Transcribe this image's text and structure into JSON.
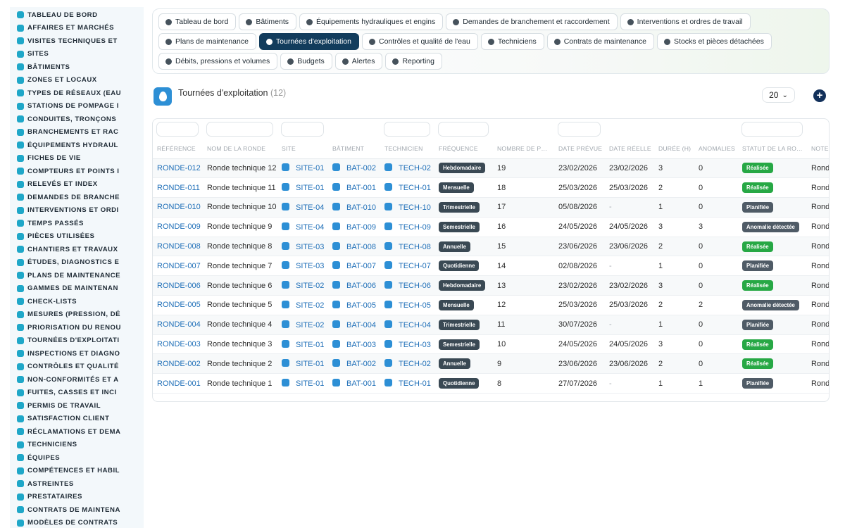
{
  "sidebar": {
    "items": [
      {
        "label": "TABLEAU DE BORD",
        "icon": "dashboard-icon"
      },
      {
        "label": "AFFAIRES ET MARCHÉS",
        "icon": "target-icon"
      },
      {
        "label": "VISITES TECHNIQUES ET",
        "icon": "clipboard-icon"
      },
      {
        "label": "SITES",
        "icon": "map-pin-icon"
      },
      {
        "label": "BÂTIMENTS",
        "icon": "building-icon"
      },
      {
        "label": "ZONES ET LOCAUX",
        "icon": "grid-icon"
      },
      {
        "label": "TYPES DE RÉSEAUX (EAU",
        "icon": "network-icon"
      },
      {
        "label": "STATIONS DE POMPAGE I",
        "icon": "pump-icon"
      },
      {
        "label": "CONDUITES, TRONÇONS",
        "icon": "pipe-icon"
      },
      {
        "label": "BRANCHEMENTS ET RAC",
        "icon": "plug-icon"
      },
      {
        "label": "ÉQUIPEMENTS HYDRAUL",
        "icon": "gear-icon"
      },
      {
        "label": "FICHES DE VIE",
        "icon": "history-icon"
      },
      {
        "label": "COMPTEURS ET POINTS I",
        "icon": "gauge-icon"
      },
      {
        "label": "RELEVÉS ET INDEX",
        "icon": "list-icon"
      },
      {
        "label": "DEMANDES DE BRANCHE",
        "icon": "request-icon"
      },
      {
        "label": "INTERVENTIONS ET ORDI",
        "icon": "wrench-icon"
      },
      {
        "label": "TEMPS PASSÉS",
        "icon": "clock-icon"
      },
      {
        "label": "PIÈCES UTILISÉES",
        "icon": "box-icon"
      },
      {
        "label": "CHANTIERS ET TRAVAUX",
        "icon": "hammer-icon"
      },
      {
        "label": "ÉTUDES, DIAGNOSTICS E",
        "icon": "search-icon"
      },
      {
        "label": "PLANS DE MAINTENANCE",
        "icon": "calendar-icon"
      },
      {
        "label": "GAMMES DE MAINTENAN",
        "icon": "layers-icon"
      },
      {
        "label": "CHECK-LISTS",
        "icon": "checklist-icon"
      },
      {
        "label": "MESURES (PRESSION, DÉ",
        "icon": "thermometer-icon"
      },
      {
        "label": "PRIORISATION DU RENOU",
        "icon": "chart-icon"
      },
      {
        "label": "TOURNÉES D'EXPLOITATI",
        "icon": "route-icon"
      },
      {
        "label": "INSPECTIONS ET DIAGNO",
        "icon": "eye-icon"
      },
      {
        "label": "CONTRÔLES ET QUALITÉ",
        "icon": "flask-icon"
      },
      {
        "label": "NON-CONFORMITÉS ET A",
        "icon": "alert-icon"
      },
      {
        "label": "FUITES, CASSES ET INCI",
        "icon": "warning-icon"
      },
      {
        "label": "PERMIS DE TRAVAIL",
        "icon": "document-icon"
      },
      {
        "label": "SATISFACTION CLIENT",
        "icon": "smile-icon"
      },
      {
        "label": "RÉCLAMATIONS ET DEMA",
        "icon": "chat-icon"
      },
      {
        "label": "TECHNICIENS",
        "icon": "person-icon"
      },
      {
        "label": "ÉQUIPES",
        "icon": "team-icon"
      },
      {
        "label": "COMPÉTENCES ET HABIL",
        "icon": "badge-icon"
      },
      {
        "label": "ASTREINTES",
        "icon": "phone-icon"
      },
      {
        "label": "PRESTATAIRES",
        "icon": "handshake-icon"
      },
      {
        "label": "CONTRATS DE MAINTENA",
        "icon": "contract-icon"
      },
      {
        "label": "MODÈLES DE CONTRATS",
        "icon": "template-icon"
      }
    ]
  },
  "tabs": {
    "row1": [
      {
        "label": "Tableau de bord",
        "icon": "dashboard-icon"
      },
      {
        "label": "Bâtiments",
        "icon": "building-icon"
      },
      {
        "label": "Équipements hydrauliques et engins",
        "icon": "gears-icon"
      },
      {
        "label": "Demandes de branchement et raccordement",
        "icon": "question-icon"
      },
      {
        "label": "Interventions et ordres de travail",
        "icon": "clipboard-icon"
      }
    ],
    "row2": [
      {
        "label": "Plans de maintenance",
        "icon": "calendar-icon"
      },
      {
        "label": "Tournées d'exploitation",
        "icon": "route-icon",
        "active": true
      },
      {
        "label": "Contrôles et qualité de l'eau",
        "icon": "clipboard-check-icon"
      },
      {
        "label": "Techniciens",
        "icon": "helmet-icon"
      },
      {
        "label": "Contrats de maintenance",
        "icon": "contract-icon"
      },
      {
        "label": "Stocks et pièces détachées",
        "icon": "boxes-icon"
      }
    ],
    "row3": [
      {
        "label": "Débits, pressions et volumes",
        "icon": "bolt-icon"
      },
      {
        "label": "Budgets",
        "icon": "money-icon"
      },
      {
        "label": "Alertes",
        "icon": "bell-icon"
      },
      {
        "label": "Reporting",
        "icon": "pie-icon"
      }
    ]
  },
  "page": {
    "title": "Tournées d'exploitation",
    "count": "(12)",
    "page_size": "20",
    "page_size_caret": "⌄",
    "add_label": "+"
  },
  "table": {
    "columns": [
      "RÉFÉRENCE",
      "NOM DE LA RONDE",
      "SITE",
      "BÂTIMENT",
      "TECHNICIEN",
      "FRÉQUENCE",
      "NOMBRE DE P…",
      "DATE PRÉVUE",
      "DATE RÉELLE",
      "DURÉE (H)",
      "ANOMALIES",
      "STATUT DE LA RO…",
      "NOTE"
    ],
    "rows": [
      {
        "ref": "RONDE-012",
        "name": "Ronde technique 12",
        "site": "SITE-01",
        "building": "BAT-002",
        "tech": "TECH-02",
        "freq": "Hebdomadaire",
        "points": "19",
        "planned": "23/02/2026",
        "actual": "23/02/2026",
        "duration": "3",
        "anomalies": "0",
        "status": "Réalisée",
        "status_kind": "ok",
        "note": "Ronde"
      },
      {
        "ref": "RONDE-011",
        "name": "Ronde technique 11",
        "site": "SITE-01",
        "building": "BAT-001",
        "tech": "TECH-01",
        "freq": "Mensuelle",
        "points": "18",
        "planned": "25/03/2026",
        "actual": "25/03/2026",
        "duration": "2",
        "anomalies": "0",
        "status": "Réalisée",
        "status_kind": "ok",
        "note": "Ronde"
      },
      {
        "ref": "RONDE-010",
        "name": "Ronde technique 10",
        "site": "SITE-04",
        "building": "BAT-010",
        "tech": "TECH-10",
        "freq": "Trimestrielle",
        "points": "17",
        "planned": "05/08/2026",
        "actual": "-",
        "duration": "1",
        "anomalies": "0",
        "status": "Planifiée",
        "status_kind": "plan",
        "note": "Ronde"
      },
      {
        "ref": "RONDE-009",
        "name": "Ronde technique 9",
        "site": "SITE-04",
        "building": "BAT-009",
        "tech": "TECH-09",
        "freq": "Semestrielle",
        "points": "16",
        "planned": "24/05/2026",
        "actual": "24/05/2026",
        "duration": "3",
        "anomalies": "3",
        "status": "Anomalie détectée",
        "status_kind": "anom",
        "note": "Ronde"
      },
      {
        "ref": "RONDE-008",
        "name": "Ronde technique 8",
        "site": "SITE-03",
        "building": "BAT-008",
        "tech": "TECH-08",
        "freq": "Annuelle",
        "points": "15",
        "planned": "23/06/2026",
        "actual": "23/06/2026",
        "duration": "2",
        "anomalies": "0",
        "status": "Réalisée",
        "status_kind": "ok",
        "note": "Ronde"
      },
      {
        "ref": "RONDE-007",
        "name": "Ronde technique 7",
        "site": "SITE-03",
        "building": "BAT-007",
        "tech": "TECH-07",
        "freq": "Quotidienne",
        "points": "14",
        "planned": "02/08/2026",
        "actual": "-",
        "duration": "1",
        "anomalies": "0",
        "status": "Planifiée",
        "status_kind": "plan",
        "note": "Ronde"
      },
      {
        "ref": "RONDE-006",
        "name": "Ronde technique 6",
        "site": "SITE-02",
        "building": "BAT-006",
        "tech": "TECH-06",
        "freq": "Hebdomadaire",
        "points": "13",
        "planned": "23/02/2026",
        "actual": "23/02/2026",
        "duration": "3",
        "anomalies": "0",
        "status": "Réalisée",
        "status_kind": "ok",
        "note": "Ronde"
      },
      {
        "ref": "RONDE-005",
        "name": "Ronde technique 5",
        "site": "SITE-02",
        "building": "BAT-005",
        "tech": "TECH-05",
        "freq": "Mensuelle",
        "points": "12",
        "planned": "25/03/2026",
        "actual": "25/03/2026",
        "duration": "2",
        "anomalies": "2",
        "status": "Anomalie détectée",
        "status_kind": "anom",
        "note": "Ronde"
      },
      {
        "ref": "RONDE-004",
        "name": "Ronde technique 4",
        "site": "SITE-02",
        "building": "BAT-004",
        "tech": "TECH-04",
        "freq": "Trimestrielle",
        "points": "11",
        "planned": "30/07/2026",
        "actual": "-",
        "duration": "1",
        "anomalies": "0",
        "status": "Planifiée",
        "status_kind": "plan",
        "note": "Ronde"
      },
      {
        "ref": "RONDE-003",
        "name": "Ronde technique 3",
        "site": "SITE-01",
        "building": "BAT-003",
        "tech": "TECH-03",
        "freq": "Semestrielle",
        "points": "10",
        "planned": "24/05/2026",
        "actual": "24/05/2026",
        "duration": "3",
        "anomalies": "0",
        "status": "Réalisée",
        "status_kind": "ok",
        "note": "Ronde"
      },
      {
        "ref": "RONDE-002",
        "name": "Ronde technique 2",
        "site": "SITE-01",
        "building": "BAT-002",
        "tech": "TECH-02",
        "freq": "Annuelle",
        "points": "9",
        "planned": "23/06/2026",
        "actual": "23/06/2026",
        "duration": "2",
        "anomalies": "0",
        "status": "Réalisée",
        "status_kind": "ok",
        "note": "Ronde"
      },
      {
        "ref": "RONDE-001",
        "name": "Ronde technique 1",
        "site": "SITE-01",
        "building": "BAT-001",
        "tech": "TECH-01",
        "freq": "Quotidienne",
        "points": "8",
        "planned": "27/07/2026",
        "actual": "-",
        "duration": "1",
        "anomalies": "1",
        "status": "Planifiée",
        "status_kind": "plan",
        "note": "Ronde"
      }
    ]
  },
  "colors": {
    "accent": "#123c5c",
    "link": "#1f6fb8",
    "status_ok": "#27a845",
    "status_plan": "#4f5b66",
    "freq_badge": "#3a4954",
    "sidebar_bg": "#f3f8fb",
    "sidebar_icon": "#1fa7c8"
  }
}
